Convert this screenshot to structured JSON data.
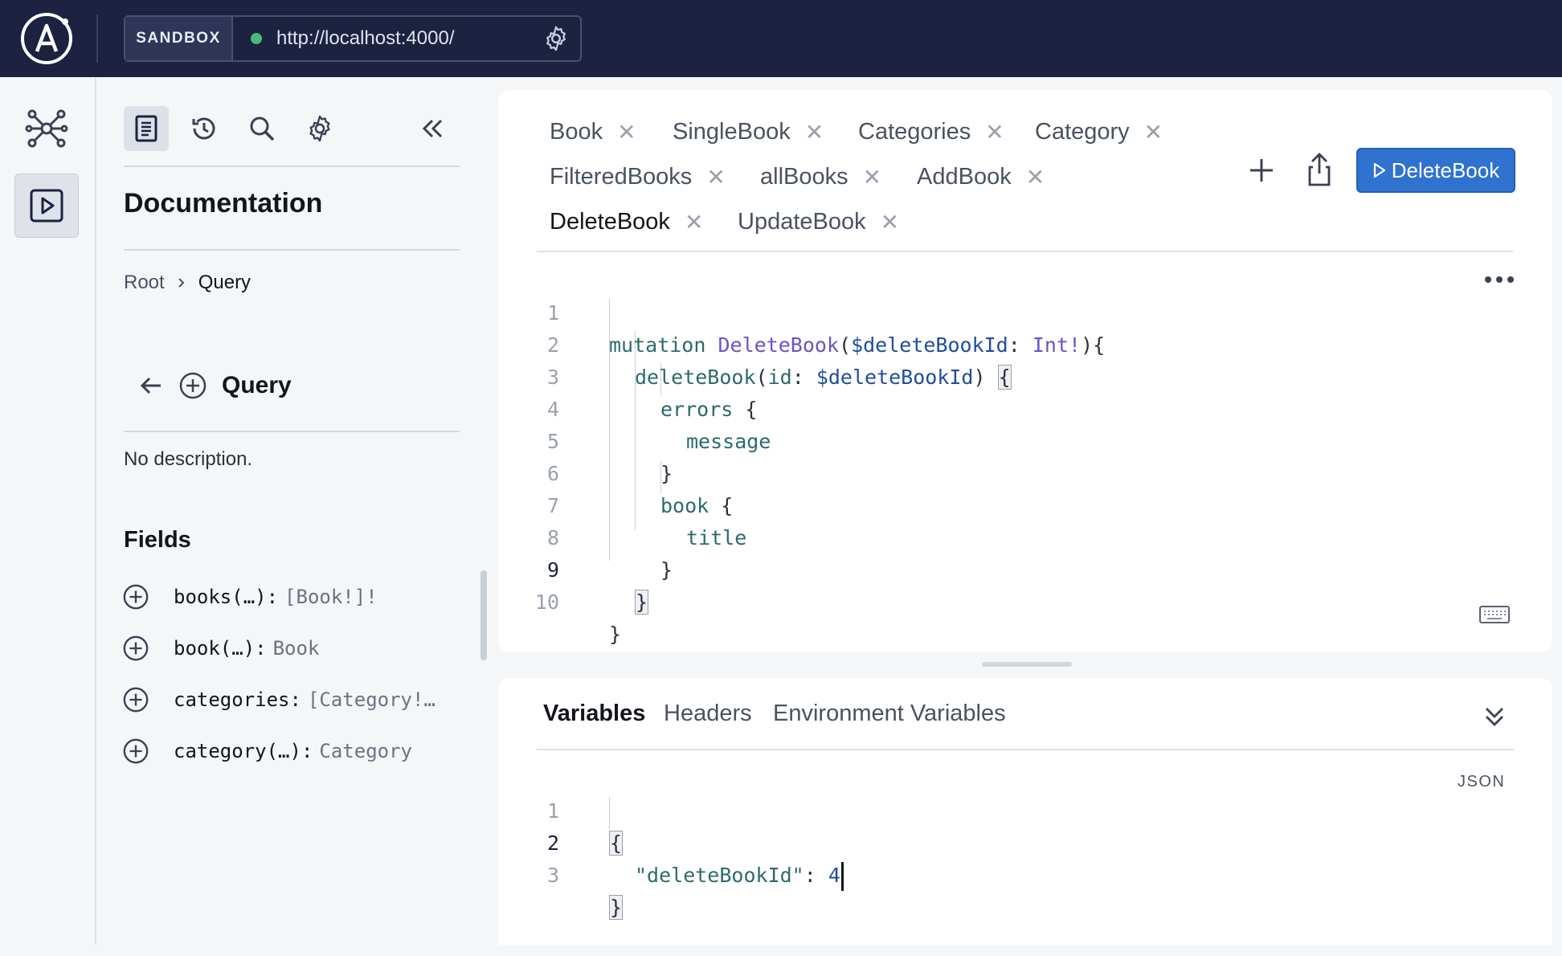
{
  "topbar": {
    "sandbox_label": "SANDBOX",
    "endpoint_url": "http://localhost:4000/",
    "status_color": "#4cb97b"
  },
  "docs": {
    "title": "Documentation",
    "breadcrumb": {
      "root": "Root",
      "current": "Query"
    },
    "type_name": "Query",
    "description": "No description.",
    "fields_heading": "Fields",
    "fields": [
      {
        "name": "books(…):",
        "type": "[Book!]!"
      },
      {
        "name": "book(…):",
        "type": "Book"
      },
      {
        "name": "categories:",
        "type": "[Category!…"
      },
      {
        "name": "category(…):",
        "type": "Category"
      }
    ]
  },
  "tabs": [
    {
      "label": "Book"
    },
    {
      "label": "SingleBook"
    },
    {
      "label": "Categories"
    },
    {
      "label": "Category"
    },
    {
      "label": "FilteredBooks"
    },
    {
      "label": "allBooks"
    },
    {
      "label": "AddBook"
    },
    {
      "label": "DeleteBook"
    },
    {
      "label": "UpdateBook"
    }
  ],
  "run_button": {
    "label": "DeleteBook",
    "color": "#2f72d0"
  },
  "operation": {
    "line_numbers": [
      "1",
      "2",
      "3",
      "4",
      "5",
      "6",
      "7",
      "8",
      "9",
      "10"
    ],
    "l1": {
      "kw": "mutation",
      "name": "DeleteBook",
      "open": "(",
      "var": "$deleteBookId",
      "colon": ":",
      "type": "Int!",
      "close": "){"
    },
    "l2": {
      "field": "deleteBook",
      "open": "(",
      "arg": "id",
      "colon": ":",
      "var": "$deleteBookId",
      "close": ")",
      "brace": "{"
    },
    "l3": {
      "field": "errors",
      "brace": "{"
    },
    "l4": {
      "field": "message"
    },
    "l5": {
      "brace": "}"
    },
    "l6": {
      "field": "book",
      "brace": "{"
    },
    "l7": {
      "field": "title"
    },
    "l8": {
      "brace": "}"
    },
    "l9": {
      "brace": "}"
    },
    "l10": {
      "brace": "}"
    }
  },
  "variables_panel": {
    "tabs": [
      "Variables",
      "Headers",
      "Environment Variables"
    ],
    "format_label": "JSON",
    "line_numbers": [
      "1",
      "2",
      "3"
    ],
    "open": "{",
    "key": "\"deleteBookId\"",
    "colon": ":",
    "value": "4",
    "close": "}"
  }
}
